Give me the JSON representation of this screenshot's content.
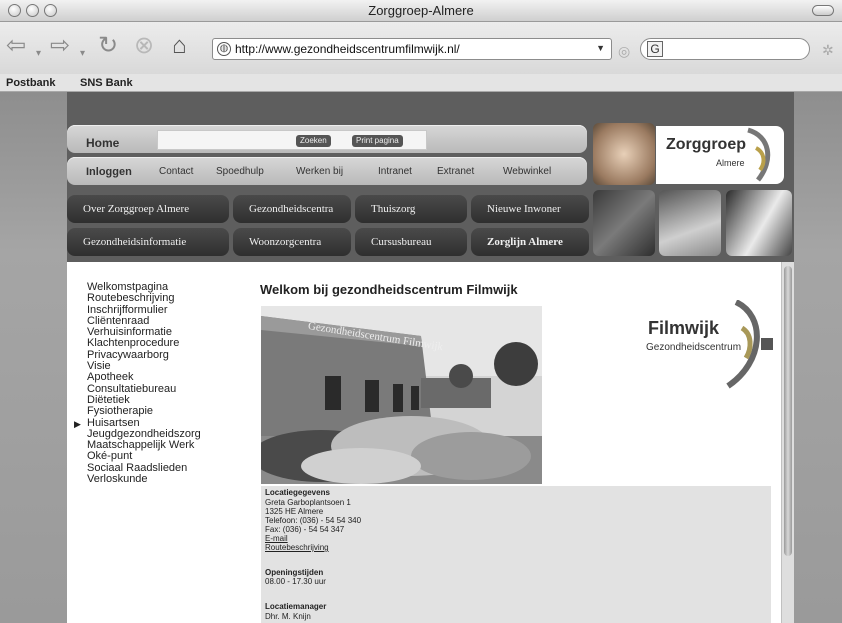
{
  "window": {
    "title": "Zorggroep-Almere"
  },
  "toolbar": {
    "url": "http://www.gezondheidscentrumfilmwijk.nl/"
  },
  "bookmarks": [
    "Postbank",
    "SNS Bank"
  ],
  "header": {
    "home": "Home",
    "search_button": "Zoeken",
    "print_button": "Print pagina",
    "menu2": [
      "Inloggen",
      "Contact",
      "Spoedhulp",
      "Werken bij",
      "Intranet",
      "Extranet",
      "Webwinkel"
    ],
    "dark_buttons": [
      "Over Zorggroep Almere",
      "Gezondheidscentra",
      "Thuiszorg",
      "Nieuwe Inwoner",
      "Gezondheidsinformatie",
      "Woonzorgcentra",
      "Cursusbureau",
      "Zorglijn Almere"
    ],
    "logo_main": "Zorggroep",
    "logo_sub": "Almere"
  },
  "leftnav": [
    "Welkomstpagina",
    "Routebeschrijving",
    "Inschrijfformulier",
    "Cliëntenraad",
    "Verhuisinformatie",
    "Klachtenprocedure",
    "Privacywaarborg",
    "Visie",
    "Apotheek",
    "Consultatiebureau",
    "Diëtetiek",
    "Fysiotherapie",
    "Huisartsen",
    "Jeugdgezondheidszorg",
    "Maatschappelijk Werk",
    "Oké-punt",
    "Sociaal Raadslieden",
    "Verloskunde"
  ],
  "main": {
    "heading": "Welkom bij gezondheidscentrum Filmwijk",
    "building_sign": "Gezondheidscentrum Filmwijk",
    "logo_main": "Filmwijk",
    "logo_sub": "Gezondheidscentrum"
  },
  "info": {
    "loc_title": "Locatiegegevens",
    "addr1": "Greta Garboplantsoen 1",
    "addr2": "1325 HE Almere",
    "phone": "Telefoon: (036) - 54 54 340",
    "fax": "Fax: (036) - 54 54 347",
    "email": "E-mail",
    "route": "Routebeschrijving",
    "hours_title": "Openingstijden",
    "hours": "08.00 - 17.30 uur",
    "manager_title": "Locatiemanager",
    "manager": "Dhr. M. Knijn"
  }
}
